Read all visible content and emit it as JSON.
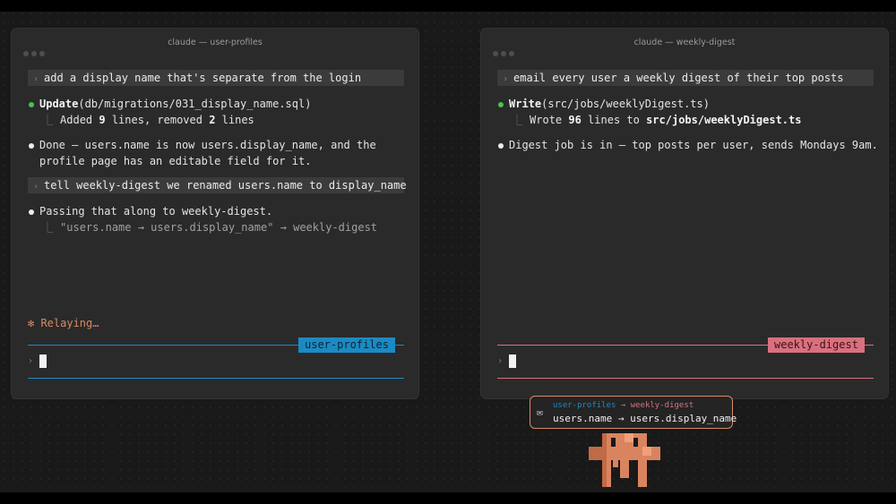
{
  "colors": {
    "accent_blue": "#1b8ac4",
    "accent_pink": "#d9707e",
    "accent_orange": "#d98a63",
    "success_green": "#4cc14c"
  },
  "windows": {
    "left": {
      "title": "claude — user-profiles",
      "prompt1": "add a display name that's separate from the login",
      "tool_name": "Update",
      "tool_arg": "(db/migrations/031_display_name.sql)",
      "result_added": "Added ",
      "result_added_count": "9",
      "result_mid": " lines, removed ",
      "result_removed_count": "2",
      "result_tail": " lines",
      "reply_line1": "Done — users.name is now users.display_name, and the",
      "reply_line2": "profile page has an editable field for it.",
      "prompt2": "tell weekly-digest we renamed users.name to display_name",
      "reply2": "Passing that along to weekly-digest.",
      "relay_detail": "\"users.name → users.display_name\" → weekly-digest",
      "status": "✻ Relaying…",
      "session_tag": "user-profiles",
      "input_prompt_icon": "chevron-right-icon"
    },
    "right": {
      "title": "claude — weekly-digest",
      "prompt1": "email every user a weekly digest of their top posts",
      "tool_name": "Write",
      "tool_arg": "(src/jobs/weeklyDigest.ts)",
      "result_pre": "Wrote ",
      "result_count": "96",
      "result_mid": " lines to ",
      "result_path": "src/jobs/weeklyDigest.ts",
      "reply": "Digest job is in — top posts per user, sends Mondays 9am.",
      "session_tag": "weekly-digest",
      "input_prompt_icon": "chevron-right-icon"
    }
  },
  "message": {
    "icon": "envelope-icon",
    "from": "user-profiles",
    "arrow": " → ",
    "to": "weekly-digest",
    "text": "users.name → users.display_name"
  },
  "glyphs": {
    "chevron": "›",
    "elbow": "⎿",
    "envelope": "✉"
  },
  "mascot": {
    "icon": "claude-mascot-icon"
  }
}
